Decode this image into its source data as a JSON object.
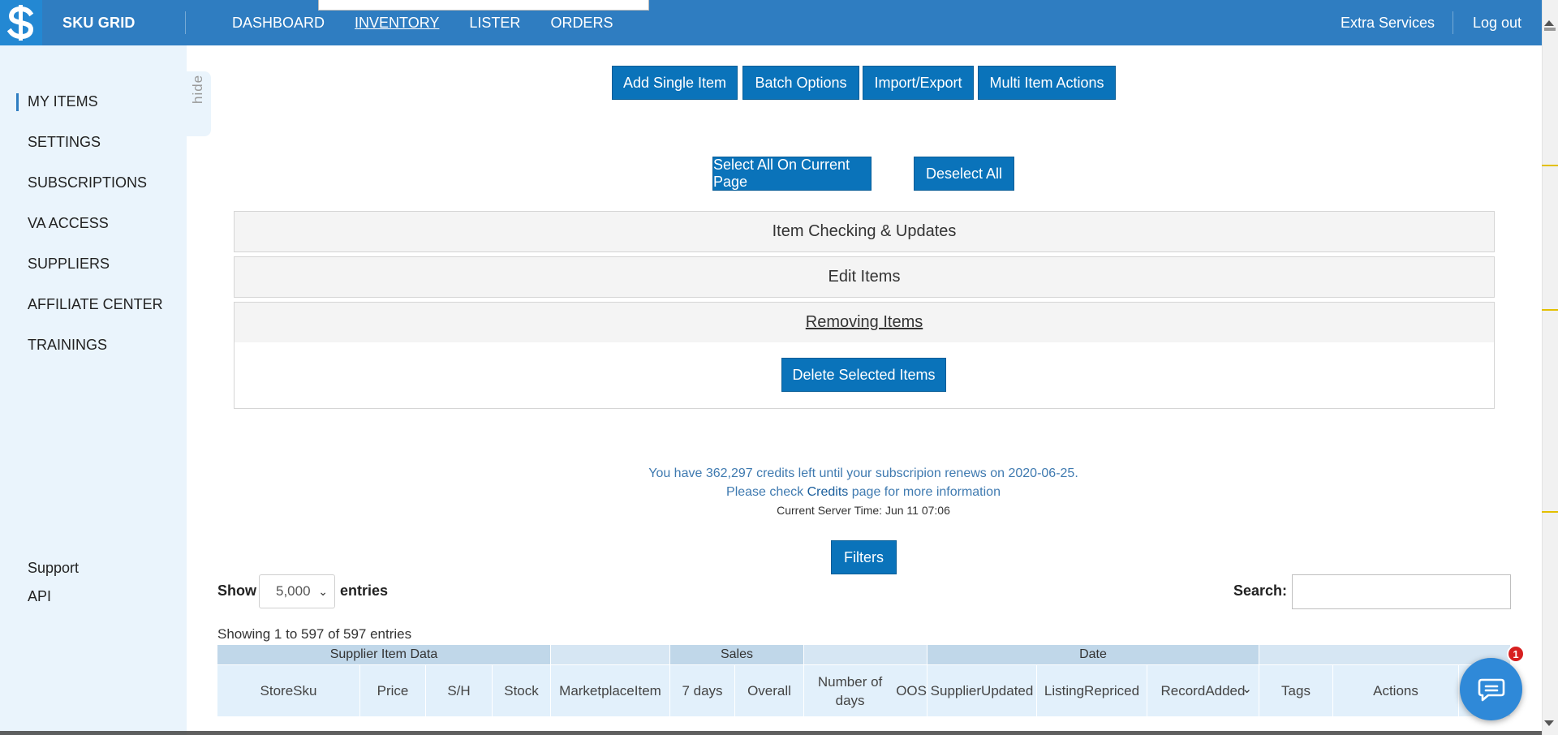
{
  "header": {
    "brand": "SKU GRID",
    "nav": [
      "DASHBOARD",
      "INVENTORY",
      "LISTER",
      "ORDERS"
    ],
    "active_nav": "INVENTORY",
    "extra_services": "Extra Services",
    "logout": "Log out",
    "colors": {
      "bar": "#2f7dc1",
      "logo_bg": "#2388d3"
    }
  },
  "sidebar": {
    "items": [
      "MY ITEMS",
      "SETTINGS",
      "SUBSCRIPTIONS",
      "VA ACCESS",
      "SUPPLIERS",
      "AFFILIATE CENTER",
      "TRAININGS"
    ],
    "active_item": "MY ITEMS",
    "hide_tab": "hide",
    "footer_links": [
      "Support",
      "API"
    ]
  },
  "actions": {
    "top_buttons": [
      "Add Single Item",
      "Batch Options",
      "Import/Export",
      "Multi Item Actions"
    ],
    "select_all": "Select All On Current Page",
    "deselect_all": "Deselect All",
    "button_color": "#0a73ba"
  },
  "accordion": {
    "sections": [
      "Item Checking & Updates",
      "Edit Items",
      "Removing Items"
    ],
    "open_section": "Removing Items",
    "delete_button": "Delete Selected Items"
  },
  "info": {
    "credits_line": "You have 362,297 credits left until your subscripion renews on 2020-06-25.",
    "check_prefix": "Please check ",
    "check_link": "Credits",
    "check_suffix": " page for more information",
    "server_time": "Current Server Time: Jun 11 07:06"
  },
  "filters_button": "Filters",
  "table_controls": {
    "show_label": "Show",
    "entries_value": "5,000",
    "entries_label": "entries",
    "search_label": "Search:",
    "search_value": "",
    "showing_text": "Showing 1 to 597 of 597 entries"
  },
  "table": {
    "group_headers": [
      "Supplier Item Data",
      "",
      "Sales",
      "",
      "Date",
      ""
    ],
    "columns": [
      [
        "Store",
        "Sku"
      ],
      [
        "Price"
      ],
      [
        "S/H"
      ],
      [
        "Stock"
      ],
      [
        "Marketplace",
        "Item"
      ],
      [
        "7 days"
      ],
      [
        "Overall"
      ],
      [
        "Number of days",
        "OOS"
      ],
      [
        "Supplier",
        "Updated"
      ],
      [
        "Listing",
        "Repriced"
      ],
      [
        "Record",
        "Added"
      ],
      [
        "Tags"
      ],
      [
        "Actions"
      ],
      [
        ""
      ]
    ],
    "sorted_column": "Record Added"
  },
  "chat": {
    "badge_count": "1",
    "icon": "chat-bubble-icon"
  }
}
